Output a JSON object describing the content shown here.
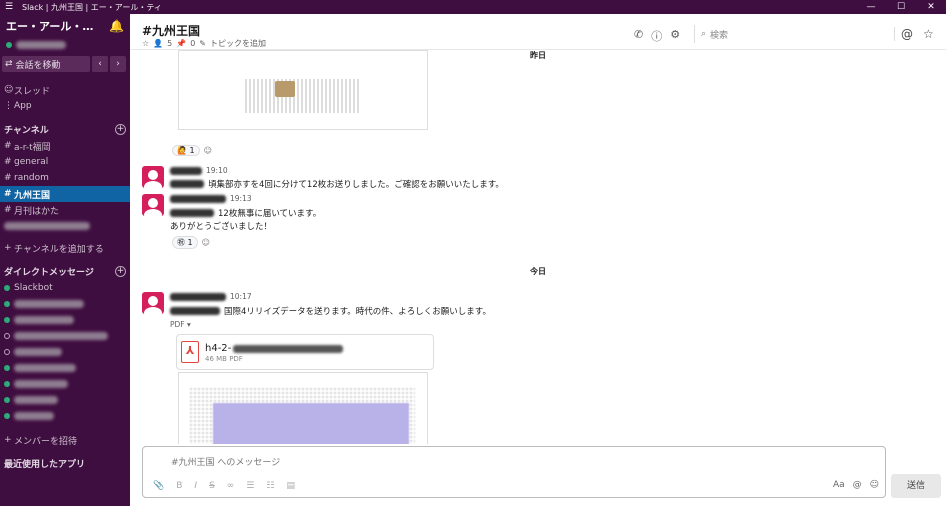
{
  "window": {
    "title": "Slack | 九州王国 | エー・アール・ティ",
    "menu_icon": "☰",
    "controls": [
      "—",
      "☐",
      "✕"
    ]
  },
  "sidebar": {
    "workspace": "エー・アール・…",
    "jump_label": "会話を移動",
    "threads": "スレッド",
    "apps": "App",
    "channels_header": "チャンネル",
    "channels": [
      {
        "name": "a-r-t福岡"
      },
      {
        "name": "general"
      },
      {
        "name": "random"
      },
      {
        "name": "九州王国",
        "active": true
      },
      {
        "name": "月刊はかた"
      }
    ],
    "add_channel": "チャンネルを追加する",
    "dm_header": "ダイレクトメッセージ",
    "dms": [
      {
        "name": "Slackbot"
      }
    ],
    "invite": "メンバーを招待",
    "recent_apps": "最近使用したアプリ"
  },
  "header": {
    "channel": "#九州王国",
    "members": "5",
    "pins": "0",
    "topic": "トピックを追加",
    "search_placeholder": "検索"
  },
  "messages": {
    "day1": "昨日",
    "reaction1_count": "1",
    "msg1_time": "19:10",
    "msg1_text": "頃集部亦すを4回に分けて12枚お送りしました。ご確認をお願いいたします。",
    "msg2_time": "19:13",
    "msg2_text": "12枚無事に届いています。",
    "msg2_text2": "ありがとうございました！",
    "reaction2_count": "1",
    "day2": "今日",
    "msg3_time": "10:17",
    "msg3_text": "国際4リリイズデータを送ります。時代の件、よろしくお願いします。",
    "pdf_label": "PDF",
    "file_name": "h4-2-",
    "file_size": "46 MB PDF"
  },
  "composer": {
    "placeholder": "#九州王国 へのメッセージ",
    "send": "送信"
  }
}
